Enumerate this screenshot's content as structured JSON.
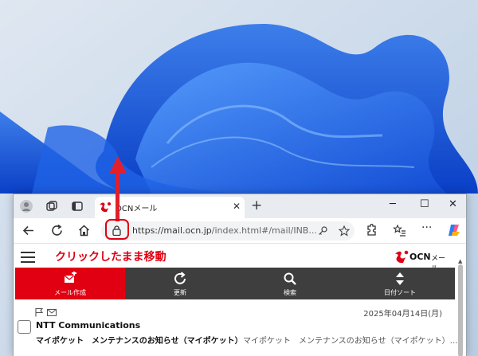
{
  "browser": {
    "tab_title": "OCNメール",
    "new_tab": "+",
    "close_tab": "✕",
    "window_controls": {
      "minimize": "─",
      "maximize": "☐",
      "close": "✕"
    },
    "url": {
      "main": "https://mail.ocn.jp",
      "rest": "/index.html#/mail/INB..."
    }
  },
  "annotation": {
    "instruction": "クリックしたまま移動"
  },
  "page": {
    "logo_text": "OCN",
    "logo_sub": "メール",
    "menu": [
      {
        "label": "メール作成",
        "icon": "compose-icon"
      },
      {
        "label": "更新",
        "icon": "refresh-icon"
      },
      {
        "label": "検索",
        "icon": "search-icon"
      },
      {
        "label": "日付ソート",
        "icon": "sort-icon"
      }
    ],
    "mail": {
      "date": "2025年04月14日(月)",
      "sender": "NTT Communications",
      "subject": "マイポケット　メンテナンスのお知らせ（マイポケット）",
      "preview": "マイポケット　メンテナンスのお知らせ（マイポケット）…"
    }
  },
  "colors": {
    "accent": "#e00012",
    "menubar": "#3e3e3e",
    "arrow": "#e1202c"
  }
}
